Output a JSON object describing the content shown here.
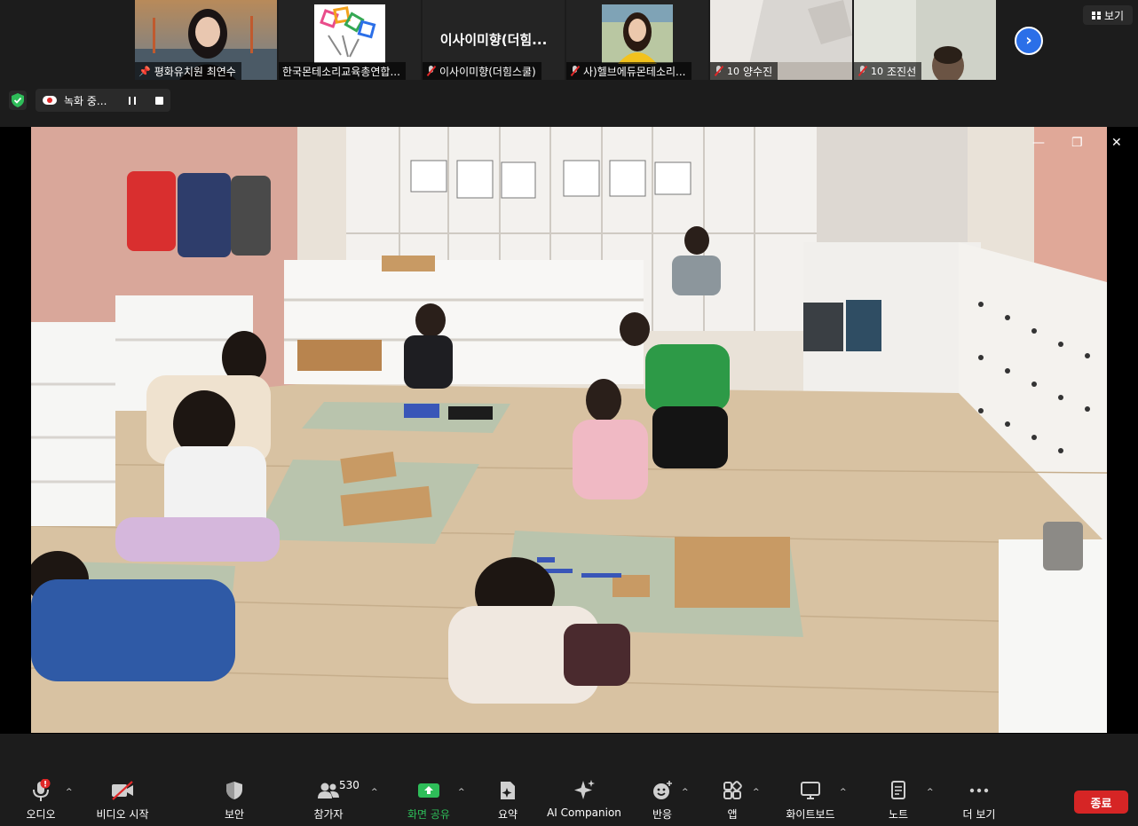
{
  "gallery": {
    "tiles": [
      {
        "name": "평화유치원 최연수",
        "mic": "pinned",
        "active": true
      },
      {
        "name": "한국몬테소리교육총연합...",
        "mic": "none"
      },
      {
        "name": "이사이미향(더힘스쿨)",
        "title": "이사이미향(더힘...",
        "mic": "muted"
      },
      {
        "name": "사)헬브에듀몬테소리...",
        "mic": "muted"
      },
      {
        "name": "양수진",
        "prefix": "10",
        "mic": "muted"
      },
      {
        "name": "조진선",
        "prefix": "10",
        "mic": "muted"
      }
    ],
    "view_label": "보기"
  },
  "status": {
    "recording_label": "녹화 중..."
  },
  "toolbar": {
    "audio_label": "오디오",
    "video_label": "비디오 시작",
    "security_label": "보안",
    "participants_label": "참가자",
    "participants_count": "530",
    "share_label": "화면 공유",
    "summary_label": "요약",
    "ai_label": "AI Companion",
    "reactions_label": "반응",
    "apps_label": "앱",
    "whiteboard_label": "화이트보드",
    "notes_label": "노트",
    "more_label": "더 보기",
    "end_label": "종료"
  },
  "colors": {
    "background": "#1c1c1c",
    "active_speaker": "#7bc043",
    "share_green": "#2ebd59",
    "end_red": "#d62525",
    "next_blue": "#2b6fe8",
    "muted_red": "#e02828"
  }
}
